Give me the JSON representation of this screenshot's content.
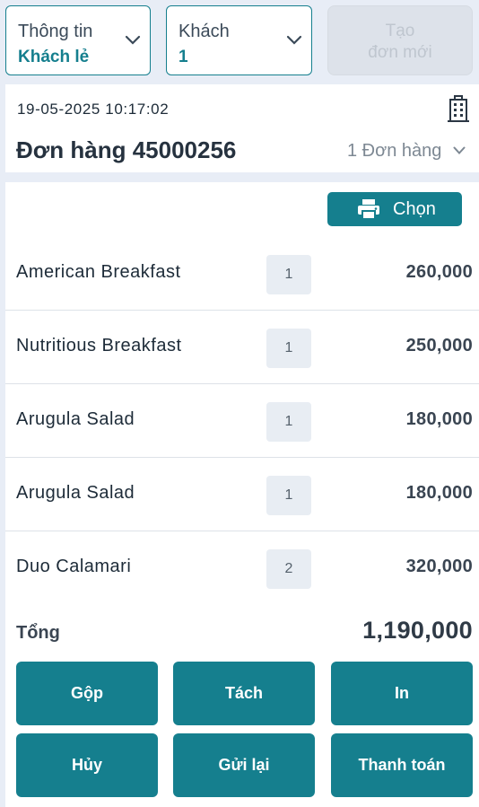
{
  "top_bar": {
    "info": {
      "label": "Thông tin",
      "value": "Khách lẻ"
    },
    "guest": {
      "label": "Khách",
      "value": "1"
    },
    "new_order_label": "Tạo\nđơn mới"
  },
  "order": {
    "timestamp": "19-05-2025 10:17:02",
    "title": "Đơn hàng 45000256",
    "count_label": "1 Đơn hàng",
    "select_button_label": "Chọn",
    "items": [
      {
        "name": "American Breakfast",
        "qty": "1",
        "price": "260,000"
      },
      {
        "name": "Nutritious Breakfast",
        "qty": "1",
        "price": "250,000"
      },
      {
        "name": "Arugula Salad",
        "qty": "1",
        "price": "180,000"
      },
      {
        "name": "Arugula Salad",
        "qty": "1",
        "price": "180,000"
      },
      {
        "name": "Duo Calamari",
        "qty": "2",
        "price": "320,000"
      }
    ],
    "total_label": "Tổng",
    "total_value": "1,190,000"
  },
  "actions": {
    "merge": "Gộp",
    "split": "Tách",
    "print": "In",
    "cancel": "Hủy",
    "resend": "Gửi lại",
    "pay": "Thanh toán"
  },
  "icons": {
    "chevron": "chevron-down-icon",
    "building": "building-icon",
    "printer": "printer-icon"
  },
  "colors": {
    "accent": "#157f8e",
    "background": "#e8edf6",
    "disabled": "#dde2ea"
  }
}
